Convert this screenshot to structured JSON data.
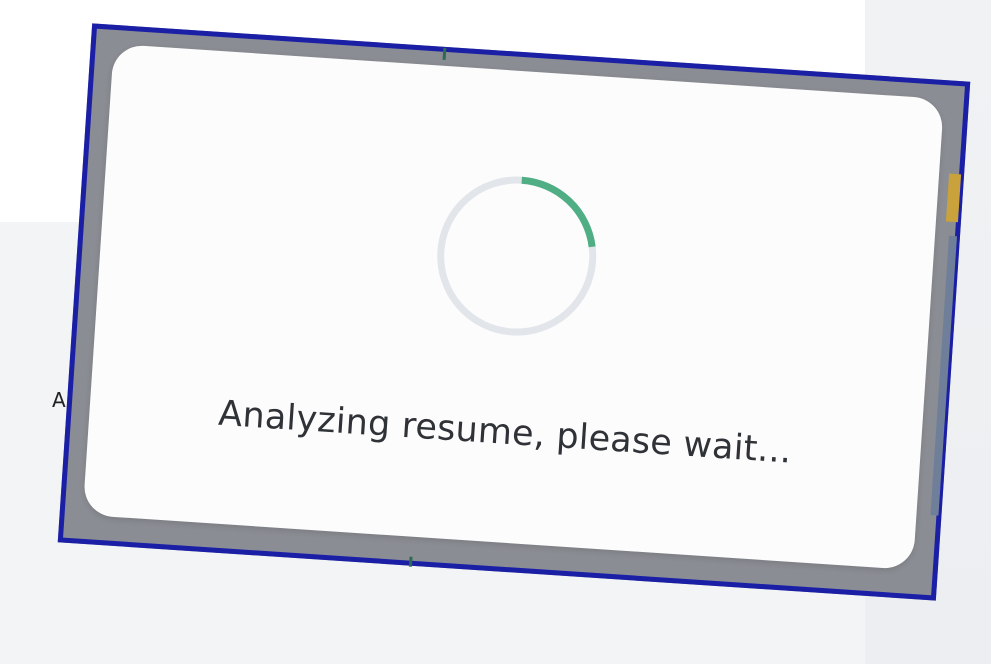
{
  "modal": {
    "message": "Analyzing resume, please wait...",
    "spinner_progress": 0.22
  },
  "background": {
    "partial_glyph": "A"
  },
  "colors": {
    "frame_border": "#1a1fa6",
    "spinner_track": "#e2e5ea",
    "spinner_arc": "#4fae84",
    "modal_bg": "#fcfcfd"
  }
}
